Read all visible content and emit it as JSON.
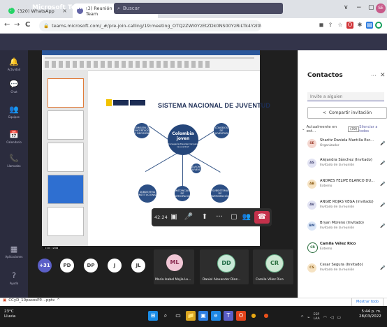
{
  "browser": {
    "tabs": [
      {
        "title": "(320) WhatsApp",
        "color": "#25d366"
      },
      {
        "title": "(3) Reunión | Microsoft Team",
        "color": "#6264a7"
      }
    ],
    "new_tab": "+",
    "window_buttons": [
      "∨",
      "−",
      "▢",
      "✕"
    ],
    "url": "teams.microsoft.com/_#/pre-join-calling/19:meeting_OTQ2ZWI0YzEtZDk0NS00YzRiLTk4YzItMDdiNmNiZjcxODEx@thread.v2",
    "nav": {
      "back": "←",
      "forward": "→",
      "reload": "C"
    }
  },
  "teams": {
    "app_name": "Microsoft Teams",
    "search_placeholder": "Buscar",
    "user_initials": "SE",
    "more": "···",
    "rail": [
      {
        "label": "Actividad",
        "icon": "bell-icon",
        "glyph": "🔔"
      },
      {
        "label": "Chat",
        "icon": "chat-icon",
        "glyph": "💬"
      },
      {
        "label": "Equipos",
        "icon": "teams-icon",
        "glyph": "👥"
      },
      {
        "label": "Calendario",
        "icon": "calendar-icon",
        "glyph": "📅"
      },
      {
        "label": "Llamadas",
        "icon": "phone-icon",
        "glyph": "📞"
      },
      {
        "label": "Aplicaciones",
        "icon": "apps-icon",
        "glyph": "▦"
      },
      {
        "label": "Ayuda",
        "icon": "help-icon",
        "glyph": "?"
      }
    ]
  },
  "shared_doc": {
    "title": "SISTEMA NACIONAL DE JUVENTUD",
    "center": [
      "Colombia joven",
      "Consejería Presidencial para la Juventud"
    ],
    "nodes": [
      "COMISIÓN DE CONCERTACIÓN Y DECISIÓN",
      "CONSEJOS DE JUVENTUD",
      "INSTANCIAS DE PARTICIPACIÓN",
      "PLATAFORMAS DE JUVENTUD",
      "SUBSISTEMA INSTITUCIONAL",
      "SUBSISTEMA DE PARTICIPACIÓN"
    ],
    "presenter": "JULIAN"
  },
  "call": {
    "timer": "42:24",
    "controls": [
      {
        "name": "camera-off-button",
        "glyph": "▣"
      },
      {
        "name": "mic-button",
        "glyph": "🎤"
      },
      {
        "name": "share-screen-button",
        "glyph": "⬆"
      },
      {
        "name": "more-actions-button",
        "glyph": "···"
      },
      {
        "name": "chat-toggle-button",
        "glyph": "▢"
      },
      {
        "name": "participants-button",
        "glyph": "👥"
      }
    ],
    "hangup": "☎",
    "overflow_count": "+31",
    "small_avatars": [
      {
        "initials": "PD",
        "color": "#ffffff",
        "text": "#444"
      },
      {
        "initials": "DP",
        "color": "#ffffff",
        "text": "#444"
      },
      {
        "initials": "J",
        "color": "#ffffff",
        "text": "#444"
      },
      {
        "initials": "JL",
        "color": "#ffffff",
        "text": "#444"
      }
    ],
    "tiles": [
      {
        "initials": "ML",
        "name": "Maria Isabel Mejía Lo...",
        "bg": "#f1c7d6",
        "fg": "#8a2b50"
      },
      {
        "initials": "DD",
        "name": "Daniel Alexander Diaz...",
        "bg": "#c9e8d7",
        "fg": "#1f6b46"
      },
      {
        "initials": "CR",
        "name": "Camila Vélez Rico",
        "bg": "#cde8d3",
        "fg": "#2a6e3e"
      }
    ]
  },
  "contacts": {
    "title": "Contactos",
    "more": "···",
    "close": "✕",
    "invite_placeholder": "Invite a alguien",
    "share_label": "Compartir invitación",
    "section_label": "Actualmente en est...",
    "section_count": "(39)",
    "mute_all": "Silenciar a todos",
    "people": [
      {
        "initials": "SE",
        "name": "Sharitz Daniela Mantilla Esc...",
        "role": "Organizador",
        "bg": "#f4d7d0",
        "fg": "#9a3b2a"
      },
      {
        "initials": "AS",
        "name": "Alejandra Sánchez (Invitado)",
        "role": "Invitado de la reunión",
        "bg": "#e2e3f3",
        "fg": "#464775"
      },
      {
        "initials": "AB",
        "name": "ANDRES FELIPE BLANCO DU...",
        "role": "Externo",
        "bg": "#f6e3c3",
        "fg": "#8a5a12"
      },
      {
        "initials": "AV",
        "name": "ANGIE ROJAS VEGA (Invitado)",
        "role": "Invitado de la reunión",
        "bg": "#e2e3f3",
        "fg": "#464775"
      },
      {
        "initials": "BM",
        "name": "Bryan Moreno (Invitado)",
        "role": "Invitado de la reunión",
        "bg": "#dbe6f7",
        "fg": "#2b4e8a"
      },
      {
        "initials": "CR",
        "name": "Camila Vélez Rico",
        "role": "Externo",
        "bg": "#ffffff",
        "fg": "#2a6e3e"
      },
      {
        "initials": "CS",
        "name": "Cesar Segura (Invitado)",
        "role": "Invitado de la reunión",
        "bg": "#f6e3c3",
        "fg": "#8a5a12"
      }
    ]
  },
  "downloads": {
    "file": "CCyD_10pasosPP....pptx",
    "chevron": "^",
    "show_all": "Mostrar todo"
  },
  "taskbar": {
    "temp": "23°C",
    "weather": "Lluvia",
    "lang": "ESP",
    "lang2": "LAA",
    "time": "5:44 p. m.",
    "date": "28/03/2022",
    "apps": [
      {
        "name": "windows-start-icon",
        "glyph": "⊞",
        "color": "#1a8ce6"
      },
      {
        "name": "search-taskbar-icon",
        "glyph": "⌕",
        "color": "#1b1b1b"
      },
      {
        "name": "task-view-icon",
        "glyph": "▭",
        "color": "#1b1b1b"
      },
      {
        "name": "explorer-icon",
        "glyph": "📁",
        "color": "#d8a520"
      },
      {
        "name": "store-icon",
        "glyph": "▣",
        "color": "#2d7de0"
      },
      {
        "name": "edge-icon",
        "glyph": "e",
        "color": "#1e88e5"
      },
      {
        "name": "teams-taskbar-icon",
        "glyph": "T",
        "color": "#5b5fc7"
      },
      {
        "name": "office-icon",
        "glyph": "O",
        "color": "#e3441b"
      },
      {
        "name": "chrome-icon",
        "glyph": "●",
        "color": "#e8a713"
      },
      {
        "name": "firefox-icon",
        "glyph": "●",
        "color": "#e8501b"
      }
    ]
  }
}
